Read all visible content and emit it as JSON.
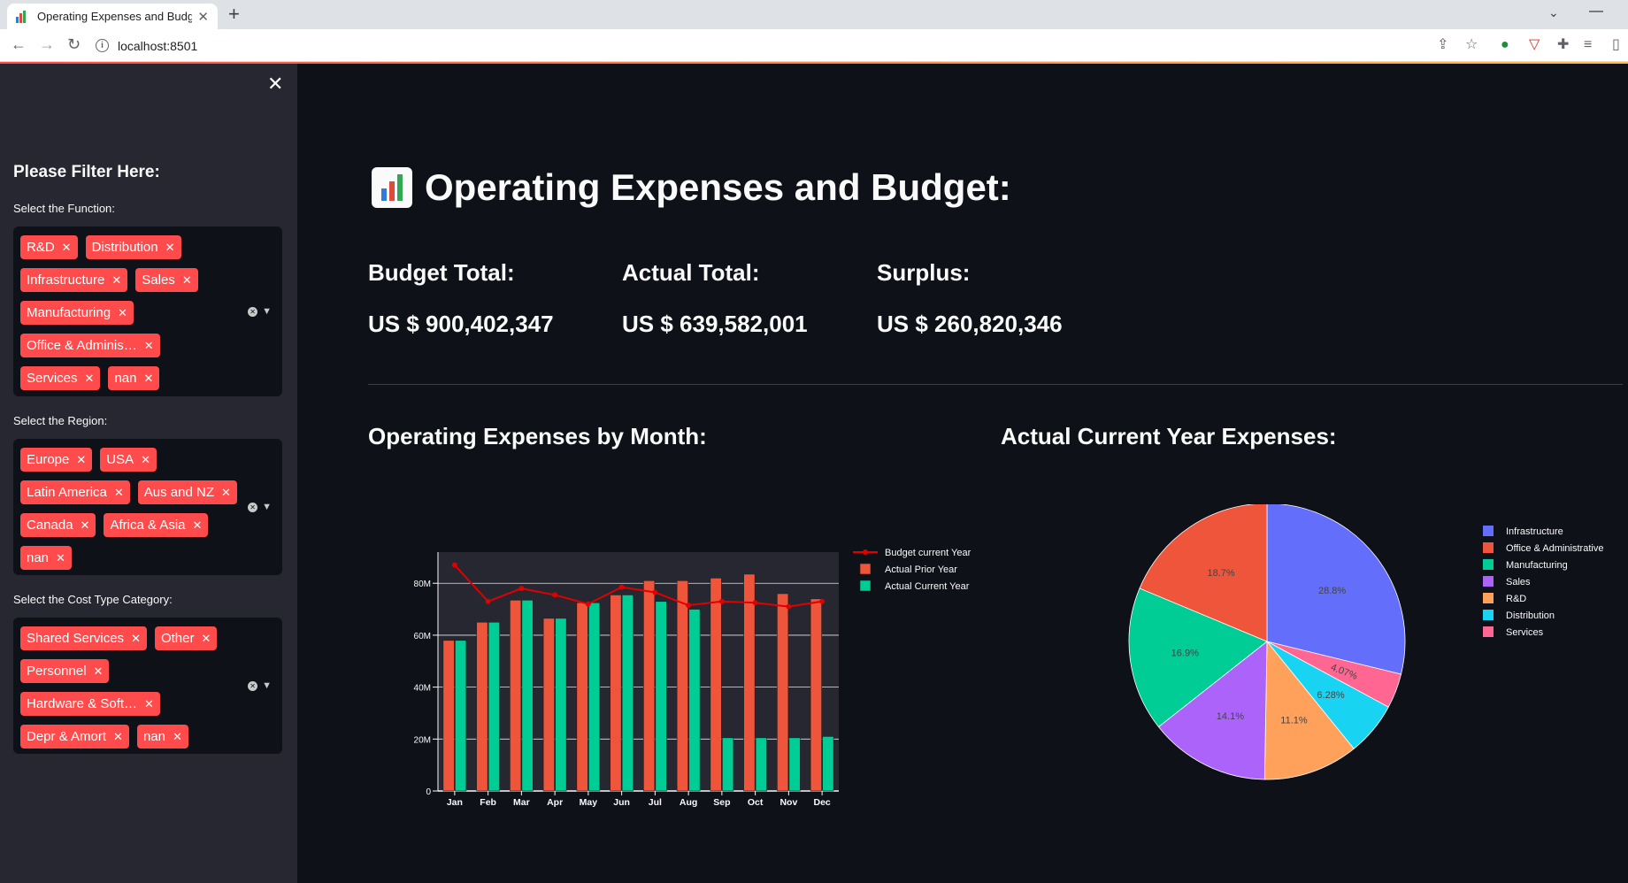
{
  "browser": {
    "tab_title": "Operating Expenses and Budget",
    "url": "localhost:8501"
  },
  "sidebar": {
    "heading": "Please Filter Here:",
    "filters": [
      {
        "label": "Select the Function:",
        "chips": [
          "R&D",
          "Distribution",
          "Infrastructure",
          "Sales",
          "Manufacturing",
          "Office & Adminis…",
          "Services",
          "nan"
        ]
      },
      {
        "label": "Select the Region:",
        "chips": [
          "Europe",
          "USA",
          "Latin America",
          "Aus and NZ",
          "Canada",
          "Africa & Asia",
          "nan"
        ]
      },
      {
        "label": "Select the Cost Type Category:",
        "chips": [
          "Shared Services",
          "Other",
          "Personnel",
          "Hardware & Soft…",
          "Depr & Amort",
          "nan"
        ]
      }
    ]
  },
  "main": {
    "title": "Operating Expenses and Budget:",
    "metrics": [
      {
        "label": "Budget Total:",
        "value": "US $ 900,402,347"
      },
      {
        "label": "Actual Total:",
        "value": "US $ 639,582,001"
      },
      {
        "label": "Surplus:",
        "value": "US $ 260,820,346"
      }
    ],
    "bar_section_title": "Operating Expenses by Month:",
    "pie_section_title": "Actual Current Year Expenses:"
  },
  "colors": {
    "accent": "#ff4b4b",
    "background": "#0e1117",
    "sidebar": "#262730",
    "budget_line": "#e00000",
    "prior_bar": "#ef553b",
    "current_bar": "#00cc96"
  },
  "chart_data": [
    {
      "type": "bar",
      "categories": [
        "Jan",
        "Feb",
        "Mar",
        "Apr",
        "May",
        "Jun",
        "Jul",
        "Aug",
        "Sep",
        "Oct",
        "Nov",
        "Dec"
      ],
      "ytick_labels": [
        "0",
        "20M",
        "40M",
        "60M",
        "80M"
      ],
      "ylim": [
        0,
        92000000
      ],
      "legend_position": "top-right",
      "series": [
        {
          "name": "Budget current Year",
          "kind": "line",
          "color": "#e00000",
          "values": [
            87000000,
            73000000,
            78000000,
            75500000,
            72000000,
            78500000,
            76500000,
            71500000,
            73000000,
            72500000,
            71000000,
            73000000
          ]
        },
        {
          "name": "Actual Prior Year",
          "kind": "bar",
          "color": "#ef553b",
          "values": [
            58000000,
            65000000,
            73500000,
            66500000,
            72500000,
            75500000,
            81000000,
            81000000,
            82000000,
            83500000,
            76000000,
            74000000
          ]
        },
        {
          "name": "Actual Current Year",
          "kind": "bar",
          "color": "#00cc96",
          "values": [
            58000000,
            65000000,
            73500000,
            66500000,
            72500000,
            75500000,
            73000000,
            70000000,
            20500000,
            20500000,
            20500000,
            21000000
          ]
        }
      ]
    },
    {
      "type": "pie",
      "legend_position": "right",
      "slices": [
        {
          "label": "Infrastructure",
          "value": 28.8,
          "text": "28.8%",
          "color": "#636efa"
        },
        {
          "label": "Services",
          "value": 4.07,
          "text": "4.07%",
          "color": "#ff6692"
        },
        {
          "label": "Distribution",
          "value": 6.28,
          "text": "6.28%",
          "color": "#19d3f3"
        },
        {
          "label": "R&D",
          "value": 11.1,
          "text": "11.1%",
          "color": "#ffa15a"
        },
        {
          "label": "Sales",
          "value": 14.1,
          "text": "14.1%",
          "color": "#ab63fa"
        },
        {
          "label": "Manufacturing",
          "value": 16.9,
          "text": "16.9%",
          "color": "#00cc96"
        },
        {
          "label": "Office & Administrative",
          "value": 18.7,
          "text": "18.7%",
          "color": "#ef553b"
        }
      ],
      "legend_order": [
        "Infrastructure",
        "Office & Administrative",
        "Manufacturing",
        "Sales",
        "R&D",
        "Distribution",
        "Services"
      ]
    }
  ]
}
